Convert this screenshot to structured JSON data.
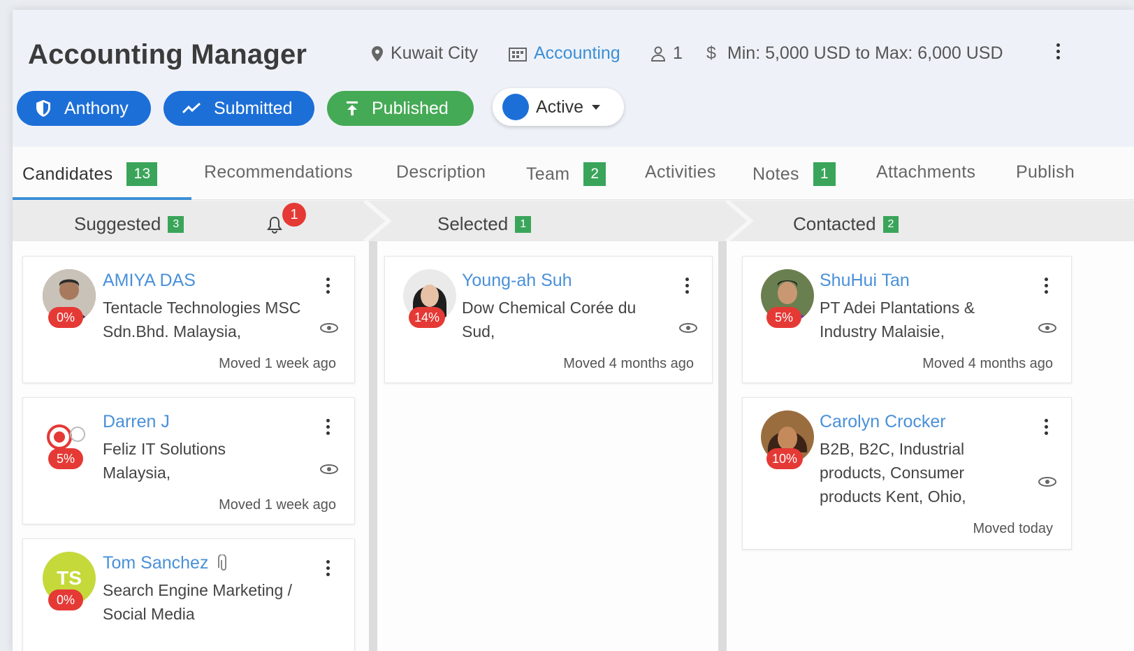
{
  "job": {
    "title": "Accounting Manager",
    "location": "Kuwait City",
    "department": "Accounting",
    "openings": "1",
    "salary": "Min: 5,000 USD to Max: 6,000 USD"
  },
  "pills": {
    "owner": "Anthony",
    "submitted": "Submitted",
    "published": "Published",
    "status": "Active"
  },
  "tabs": [
    {
      "label": "Candidates",
      "count": "13"
    },
    {
      "label": "Recommendations"
    },
    {
      "label": "Description"
    },
    {
      "label": "Team",
      "count": "2"
    },
    {
      "label": "Activities"
    },
    {
      "label": "Notes",
      "count": "1"
    },
    {
      "label": "Attachments"
    },
    {
      "label": "Publish"
    }
  ],
  "stages": [
    {
      "label": "Suggested",
      "count": "3",
      "notifications": "1"
    },
    {
      "label": "Selected",
      "count": "1"
    },
    {
      "label": "Contacted",
      "count": "2"
    }
  ],
  "candidates": {
    "suggested": [
      {
        "name": "AMIYA DAS",
        "company": "Tentacle Technologies MSC Sdn.Bhd. Malaysia,",
        "moved": "Moved 1 week ago",
        "match": "0%"
      },
      {
        "name": "Darren J",
        "company": "Feliz IT Solutions Malaysia,",
        "moved": "Moved 1 week ago",
        "match": "5%"
      },
      {
        "name": "Tom Sanchez",
        "initials": "TS",
        "company": "Search Engine Marketing / Social Media",
        "match": "0%"
      }
    ],
    "selected": [
      {
        "name": "Young-ah Suh",
        "company": "Dow Chemical Corée du Sud,",
        "moved": "Moved 4 months ago",
        "match": "14%"
      }
    ],
    "contacted": [
      {
        "name": "ShuHui Tan",
        "company": "PT Adei Plantations & Industry Malaisie,",
        "moved": "Moved 4 months ago",
        "match": "5%"
      },
      {
        "name": "Carolyn Crocker",
        "company": "B2B, B2C, Industrial products, Consumer products Kent, Ohio,",
        "moved": "Moved today",
        "match": "10%"
      }
    ]
  },
  "colors": {
    "primary": "#1d6fd8",
    "success": "#45aa55",
    "badge_green": "#3aa55a",
    "danger": "#e53935",
    "link": "#4a90d9"
  },
  "icons": [
    "location-pin-icon",
    "building-icon",
    "person-icon",
    "dollar-icon",
    "kebab-menu-icon",
    "shield-icon",
    "trend-icon",
    "upload-icon",
    "bell-icon",
    "eye-icon",
    "paperclip-icon"
  ]
}
